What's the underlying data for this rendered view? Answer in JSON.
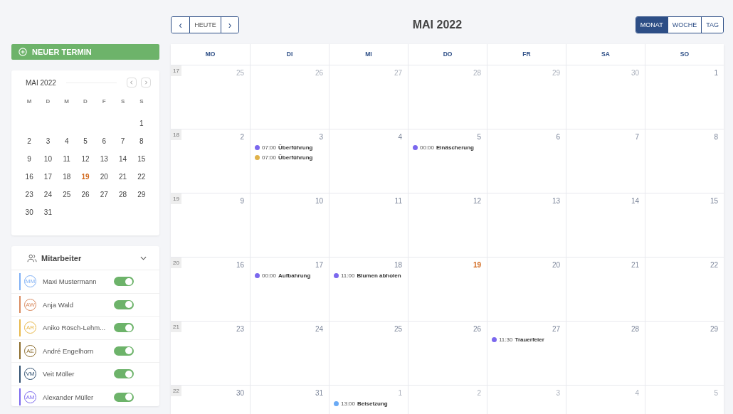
{
  "toolbar": {
    "prev": "‹",
    "today": "HEUTE",
    "next": "›",
    "title": "MAI 2022",
    "views": [
      {
        "label": "MONAT",
        "selected": true
      },
      {
        "label": "WOCHE",
        "selected": false
      },
      {
        "label": "TAG",
        "selected": false
      }
    ]
  },
  "new_button": "NEUER TERMIN",
  "mini_calendar": {
    "title": "MAI 2022",
    "weekdays": [
      "M",
      "D",
      "M",
      "D",
      "F",
      "S",
      "S"
    ],
    "weeks": [
      {
        "kind": "trailing",
        "days": [
          {
            "label": "1",
            "today": false
          }
        ]
      },
      {
        "kind": "full",
        "days": [
          {
            "label": "2",
            "today": false
          },
          {
            "label": "3",
            "today": false
          },
          {
            "label": "4",
            "today": false
          },
          {
            "label": "5",
            "today": false
          },
          {
            "label": "6",
            "today": false
          },
          {
            "label": "7",
            "today": false
          },
          {
            "label": "8",
            "today": false
          }
        ]
      },
      {
        "kind": "full",
        "days": [
          {
            "label": "9",
            "today": false
          },
          {
            "label": "10",
            "today": false
          },
          {
            "label": "11",
            "today": false
          },
          {
            "label": "12",
            "today": false
          },
          {
            "label": "13",
            "today": false
          },
          {
            "label": "14",
            "today": false
          },
          {
            "label": "15",
            "today": false
          }
        ]
      },
      {
        "kind": "full",
        "days": [
          {
            "label": "16",
            "today": false
          },
          {
            "label": "17",
            "today": false
          },
          {
            "label": "18",
            "today": false
          },
          {
            "label": "19",
            "today": true
          },
          {
            "label": "20",
            "today": false
          },
          {
            "label": "21",
            "today": false
          },
          {
            "label": "22",
            "today": false
          }
        ]
      },
      {
        "kind": "full",
        "days": [
          {
            "label": "23",
            "today": false
          },
          {
            "label": "24",
            "today": false
          },
          {
            "label": "25",
            "today": false
          },
          {
            "label": "26",
            "today": false
          },
          {
            "label": "27",
            "today": false
          },
          {
            "label": "28",
            "today": false
          },
          {
            "label": "29",
            "today": false
          }
        ]
      },
      {
        "kind": "leading",
        "days": [
          {
            "label": "30",
            "today": false
          },
          {
            "label": "31",
            "today": false
          }
        ]
      }
    ]
  },
  "staff": {
    "title": "Mitarbeiter",
    "expanded": true,
    "members": [
      {
        "initials": "MM",
        "name": "Maxi Mustermann",
        "color": "#7fb0f5",
        "on": true
      },
      {
        "initials": "AW",
        "name": "Anja Wald",
        "color": "#d98a5f",
        "on": true
      },
      {
        "initials": "AR",
        "name": "Aniko Rösch-Lehm...",
        "color": "#e8b84a",
        "on": true
      },
      {
        "initials": "AE",
        "name": "André Engelhorn",
        "color": "#8a6a2a",
        "on": true
      },
      {
        "initials": "VM",
        "name": "Veit Möller",
        "color": "#2f4f6f",
        "on": true
      },
      {
        "initials": "AM",
        "name": "Alexander Müller",
        "color": "#7b68ee",
        "on": true
      }
    ]
  },
  "calendar": {
    "weekdays": [
      "MO",
      "DI",
      "MI",
      "DO",
      "FR",
      "SA",
      "SO"
    ],
    "weeks": [
      {
        "number": "17",
        "days": [
          {
            "label": "25",
            "muted": true,
            "today": false
          },
          {
            "label": "26",
            "muted": true,
            "today": false
          },
          {
            "label": "27",
            "muted": true,
            "today": false
          },
          {
            "label": "28",
            "muted": true,
            "today": false
          },
          {
            "label": "29",
            "muted": true,
            "today": false
          },
          {
            "label": "30",
            "muted": true,
            "today": false
          },
          {
            "label": "1",
            "muted": false,
            "today": false
          }
        ]
      },
      {
        "number": "18",
        "days": [
          {
            "label": "2",
            "muted": false,
            "today": false
          },
          {
            "label": "3",
            "muted": false,
            "today": false,
            "events": [
              {
                "time": "07:00",
                "title": "Überführung",
                "color": "#7b68ee"
              },
              {
                "time": "07:00",
                "title": "Überführung",
                "color": "#e0b24a"
              }
            ]
          },
          {
            "label": "4",
            "muted": false,
            "today": false
          },
          {
            "label": "5",
            "muted": false,
            "today": false,
            "events": [
              {
                "time": "00:00",
                "title": "Einäscherung",
                "color": "#7b68ee"
              }
            ]
          },
          {
            "label": "6",
            "muted": false,
            "today": false
          },
          {
            "label": "7",
            "muted": false,
            "today": false
          },
          {
            "label": "8",
            "muted": false,
            "today": false
          }
        ]
      },
      {
        "number": "19",
        "days": [
          {
            "label": "9",
            "muted": false,
            "today": false
          },
          {
            "label": "10",
            "muted": false,
            "today": false
          },
          {
            "label": "11",
            "muted": false,
            "today": false
          },
          {
            "label": "12",
            "muted": false,
            "today": false
          },
          {
            "label": "13",
            "muted": false,
            "today": false
          },
          {
            "label": "14",
            "muted": false,
            "today": false
          },
          {
            "label": "15",
            "muted": false,
            "today": false
          }
        ]
      },
      {
        "number": "20",
        "days": [
          {
            "label": "16",
            "muted": false,
            "today": false
          },
          {
            "label": "17",
            "muted": false,
            "today": false,
            "events": [
              {
                "time": "00:00",
                "title": "Aufbahrung",
                "color": "#7b68ee"
              }
            ]
          },
          {
            "label": "18",
            "muted": false,
            "today": false,
            "events": [
              {
                "time": "11:00",
                "title": "Blumen abholen",
                "color": "#7b68ee"
              }
            ]
          },
          {
            "label": "19",
            "muted": false,
            "today": true
          },
          {
            "label": "20",
            "muted": false,
            "today": false
          },
          {
            "label": "21",
            "muted": false,
            "today": false
          },
          {
            "label": "22",
            "muted": false,
            "today": false
          }
        ]
      },
      {
        "number": "21",
        "days": [
          {
            "label": "23",
            "muted": false,
            "today": false
          },
          {
            "label": "24",
            "muted": false,
            "today": false
          },
          {
            "label": "25",
            "muted": false,
            "today": false
          },
          {
            "label": "26",
            "muted": false,
            "today": false
          },
          {
            "label": "27",
            "muted": false,
            "today": false,
            "events": [
              {
                "time": "11:30",
                "title": "Trauerfeier",
                "color": "#7b68ee"
              }
            ]
          },
          {
            "label": "28",
            "muted": false,
            "today": false
          },
          {
            "label": "29",
            "muted": false,
            "today": false
          }
        ]
      },
      {
        "number": "22",
        "days": [
          {
            "label": "30",
            "muted": false,
            "today": false
          },
          {
            "label": "31",
            "muted": false,
            "today": false
          },
          {
            "label": "1",
            "muted": true,
            "today": false,
            "events": [
              {
                "time": "13:00",
                "title": "Beisetzung",
                "color": "#6aaaf5"
              }
            ]
          },
          {
            "label": "2",
            "muted": true,
            "today": false
          },
          {
            "label": "3",
            "muted": true,
            "today": false
          },
          {
            "label": "4",
            "muted": true,
            "today": false
          },
          {
            "label": "5",
            "muted": true,
            "today": false
          }
        ]
      }
    ]
  }
}
